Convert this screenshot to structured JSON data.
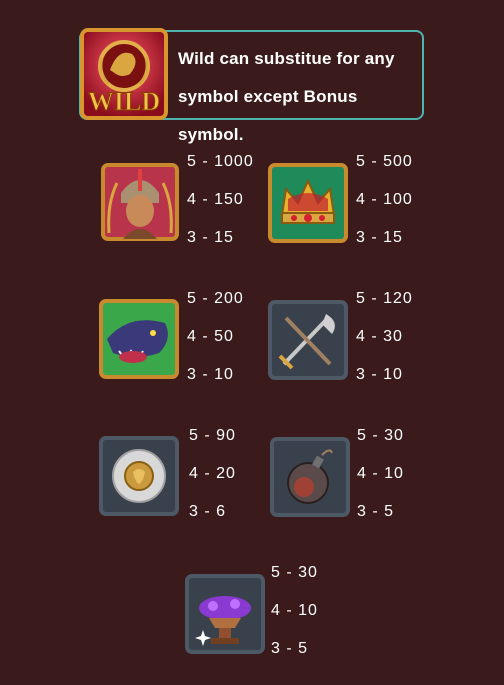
{
  "wild": {
    "icon": "wild-icon",
    "label": "WILD",
    "description": "Wild can substitue for any symbol except Bonus symbol."
  },
  "symbols": [
    {
      "icon": "gladiator-icon",
      "pays": [
        "5 - 1000",
        "4 - 150",
        "3 - 15"
      ]
    },
    {
      "icon": "crown-icon",
      "pays": [
        "5 - 500",
        "4 - 100",
        "3 - 15"
      ]
    },
    {
      "icon": "beast-icon",
      "pays": [
        "5 - 200",
        "4 - 50",
        "3 - 10"
      ]
    },
    {
      "icon": "crossed-weapons-icon",
      "pays": [
        "5 - 120",
        "4 - 30",
        "3 - 10"
      ]
    },
    {
      "icon": "shield-icon",
      "pays": [
        "5 - 90",
        "4 - 20",
        "3 - 6"
      ]
    },
    {
      "icon": "bomb-icon",
      "pays": [
        "5 - 30",
        "4 - 10",
        "3 - 5"
      ]
    },
    {
      "icon": "anvil-gems-icon",
      "pays": [
        "5 - 30",
        "4 - 10",
        "3 - 5"
      ]
    }
  ],
  "colors": {
    "background": "#3a1a1a",
    "wild_border": "#4fb3ae",
    "gold_frame": "#c98a2e",
    "stone_frame": "#4d5a66"
  }
}
